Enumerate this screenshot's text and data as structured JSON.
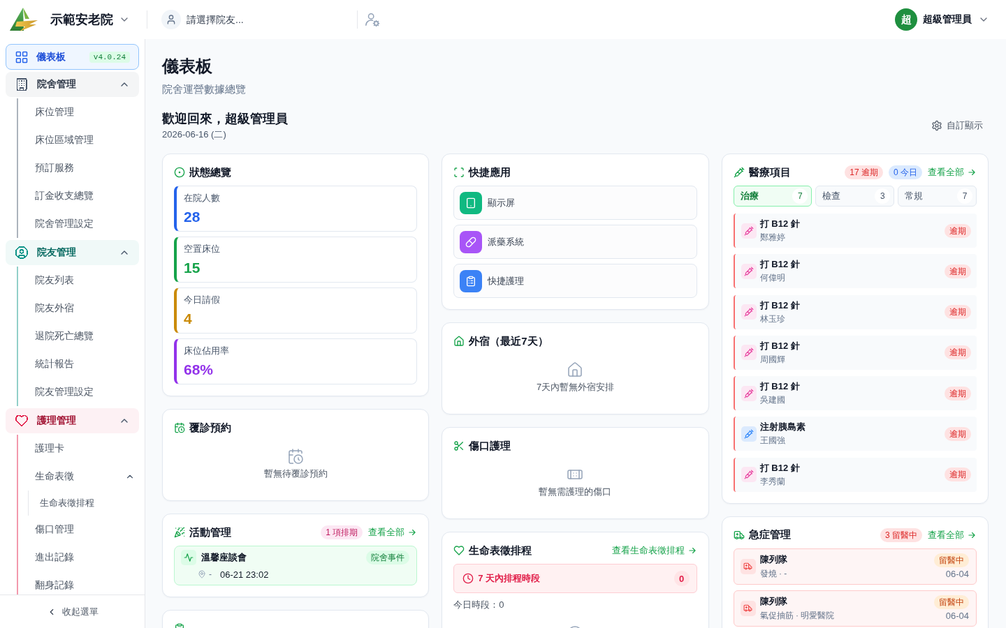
{
  "header": {
    "facility": "示範安老院",
    "resident_select": {
      "placeholder": "請選擇院友..."
    },
    "user": {
      "initial": "超",
      "name": "超級管理員"
    }
  },
  "sidebar": {
    "items": [
      {
        "kind": "dashboard",
        "label": "儀表板",
        "badge": "v4.0.24",
        "selected": true
      },
      {
        "kind": "facility",
        "label": "院舍管理",
        "color": "#475569",
        "selected": false,
        "expanded": true,
        "children": [
          {
            "label": "床位管理",
            "selected": false
          },
          {
            "label": "床位區域管理",
            "selected": false
          },
          {
            "label": "預訂服務",
            "selected": false
          },
          {
            "label": "訂金收支總覽",
            "selected": false
          },
          {
            "label": "院舍管理設定",
            "selected": false
          }
        ]
      },
      {
        "kind": "residents",
        "label": "院友管理",
        "color": "#0d9488",
        "selected": false,
        "expanded": true,
        "children": [
          {
            "label": "院友列表",
            "selected": false
          },
          {
            "label": "院友外宿",
            "selected": false
          },
          {
            "label": "退院死亡總覽",
            "selected": false
          },
          {
            "label": "統計報告",
            "selected": false
          },
          {
            "label": "院友管理設定",
            "selected": false
          }
        ]
      },
      {
        "kind": "nursing",
        "label": "護理管理",
        "color": "#e11d48",
        "selected": false,
        "expanded": true,
        "children": [
          {
            "label": "護理卡",
            "selected": false
          },
          {
            "label": "生命表徵",
            "selected": false,
            "expanded": true,
            "children": [
              {
                "label": "生命表徵排程",
                "selected": false
              }
            ]
          },
          {
            "label": "傷口管理",
            "selected": false
          },
          {
            "label": "進出記錄",
            "selected": false
          },
          {
            "label": "翻身記錄",
            "selected": false
          }
        ]
      }
    ],
    "collapse_label": "收起選單"
  },
  "page": {
    "title": "儀表板",
    "subtitle": "院舍運營數據總覽",
    "welcome": "歡迎回來，超級管理員",
    "date": "2026-06-16 (二)",
    "customize": "自訂顯示"
  },
  "columns": [
    {
      "cards": [
        {
          "kind": "status",
          "title": "狀態總覽",
          "stats": [
            {
              "label": "在院人數",
              "value": "28",
              "color": "#2563eb"
            },
            {
              "label": "空置床位",
              "value": "15",
              "color": "#16a34a"
            },
            {
              "label": "今日請假",
              "value": "4",
              "color": "#ca8a04"
            },
            {
              "label": "床位佔用率",
              "value": "68%",
              "color": "#9333ea"
            }
          ]
        },
        {
          "kind": "appointments",
          "title": "覆診預約",
          "empty_text": "暫無待覆診預約"
        },
        {
          "kind": "activities",
          "title": "活動管理",
          "badge": "1 項排期",
          "link": "查看全部",
          "items": [
            {
              "title": "溫馨座談會",
              "tag": "院舍事件",
              "location": "-",
              "time": "06-21 23:02"
            }
          ]
        },
        {
          "kind": "restraints"
        }
      ]
    },
    {
      "cards": [
        {
          "kind": "shortcuts",
          "title": "快捷應用",
          "apps": [
            {
              "kind": "display",
              "label": "顯示屏",
              "color": "#10b981"
            },
            {
              "kind": "dispensing",
              "label": "派藥系統",
              "color": "#a855f7"
            },
            {
              "kind": "nursing",
              "label": "快捷護理",
              "color": "#3b82f6"
            }
          ]
        },
        {
          "kind": "outings",
          "title": "外宿（最近7天）",
          "empty_text": "7天內暫無外宿安排"
        },
        {
          "kind": "wounds",
          "title": "傷口護理",
          "empty_text": "暫無需護理的傷口"
        },
        {
          "kind": "vitals",
          "title": "生命表徵排程",
          "link": "查看生命表徵排程",
          "alert": {
            "label": "7 天內排程時段",
            "count": "0"
          },
          "today": "今日時段：0"
        }
      ]
    },
    {
      "cards": [
        {
          "kind": "medical",
          "title": "醫療項目",
          "badges": [
            {
              "kind": "overdue",
              "text": "17 逾期"
            },
            {
              "kind": "today",
              "text": "0 今日"
            }
          ],
          "link": "查看全部",
          "tabs": [
            {
              "label": "治療",
              "count": "7",
              "selected": true
            },
            {
              "label": "檢查",
              "count": "3",
              "selected": false
            },
            {
              "label": "常規",
              "count": "7",
              "selected": false
            }
          ],
          "items": [
            {
              "title": "打 B12 針",
              "resident": "鄭雅婷",
              "status": "逾期",
              "color": "#fce7f3"
            },
            {
              "title": "打 B12 針",
              "resident": "何偉明",
              "status": "逾期",
              "color": "#fce7f3"
            },
            {
              "title": "打 B12 針",
              "resident": "林玉珍",
              "status": "逾期",
              "color": "#fce7f3"
            },
            {
              "title": "打 B12 針",
              "resident": "周國輝",
              "status": "逾期",
              "color": "#fce7f3"
            },
            {
              "title": "打 B12 針",
              "resident": "吳建國",
              "status": "逾期",
              "color": "#fce7f3"
            },
            {
              "title": "注射胰島素",
              "resident": "王國強",
              "status": "逾期",
              "color": "#dbeafe"
            },
            {
              "title": "打 B12 針",
              "resident": "李秀蘭",
              "status": "逾期",
              "color": "#fce7f3"
            }
          ]
        },
        {
          "kind": "emergency",
          "title": "急症管理",
          "badge": "3 留醫中",
          "link": "查看全部",
          "items": [
            {
              "name": "陳列隊",
              "detail": "發燒 · -",
              "status": "留醫中",
              "date": "06-04"
            },
            {
              "name": "陳列隊",
              "detail": "氣促抽筋 · 明愛醫院",
              "status": "留醫中",
              "date": "06-04"
            }
          ]
        }
      ]
    }
  ]
}
